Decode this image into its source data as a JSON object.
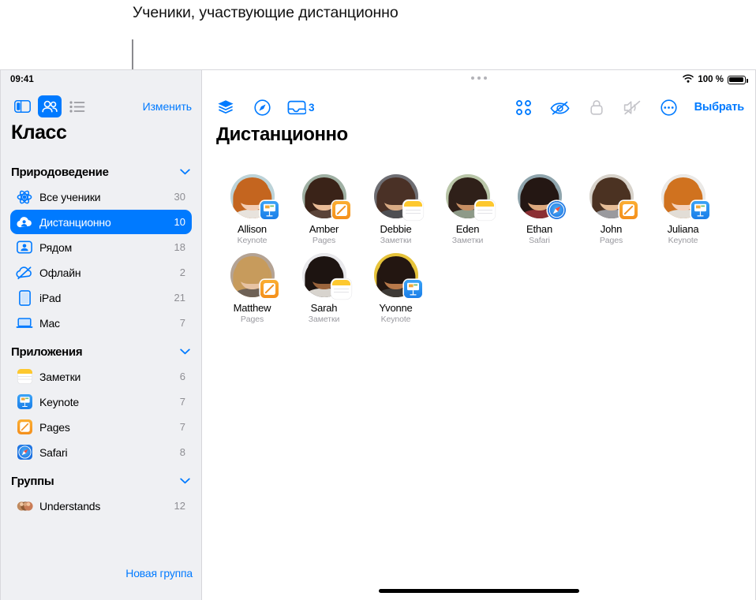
{
  "annotation": {
    "text": "Ученики, участвующие дистанционно"
  },
  "status_bar": {
    "time": "09:41",
    "wifi_icon": "wifi-icon",
    "battery_label": "100 %",
    "battery_icon": "battery-full-icon"
  },
  "sidebar": {
    "toolbar": {
      "sidebar_toggle_icon": "sidebar-toggle-icon",
      "people_icon": "people-icon",
      "list_icon": "list-icon",
      "edit_label": "Изменить"
    },
    "title": "Класс",
    "sections": [
      {
        "title": "Природоведение",
        "chevron_icon": "chevron-down-icon",
        "items": [
          {
            "label": "Все ученики",
            "count": "30",
            "icon": "atom-icon",
            "selected": false
          },
          {
            "label": "Дистанционно",
            "count": "10",
            "icon": "cloud-person-icon",
            "selected": true
          },
          {
            "label": "Рядом",
            "count": "18",
            "icon": "person-card-icon",
            "selected": false
          },
          {
            "label": "Офлайн",
            "count": "2",
            "icon": "cloud-slash-icon",
            "selected": false
          },
          {
            "label": "iPad",
            "count": "21",
            "icon": "ipad-icon",
            "selected": false
          },
          {
            "label": "Mac",
            "count": "7",
            "icon": "laptop-icon",
            "selected": false
          }
        ]
      },
      {
        "title": "Приложения",
        "chevron_icon": "chevron-down-icon",
        "items": [
          {
            "label": "Заметки",
            "count": "6",
            "icon": "notes-app-icon",
            "selected": false
          },
          {
            "label": "Keynote",
            "count": "7",
            "icon": "keynote-app-icon",
            "selected": false
          },
          {
            "label": "Pages",
            "count": "7",
            "icon": "pages-app-icon",
            "selected": false
          },
          {
            "label": "Safari",
            "count": "8",
            "icon": "safari-app-icon",
            "selected": false
          }
        ]
      },
      {
        "title": "Группы",
        "chevron_icon": "chevron-down-icon",
        "items": [
          {
            "label": "Understands",
            "count": "12",
            "icon": "group-avatars-icon",
            "selected": false
          }
        ]
      }
    ],
    "new_group_label": "Новая группа"
  },
  "main": {
    "grabber_icon": "multitasking-grabber-icon",
    "toolbar_left": [
      {
        "name": "layers-icon",
        "label": ""
      },
      {
        "name": "safari-compass-icon",
        "label": ""
      },
      {
        "name": "tray-icon",
        "label": "3"
      }
    ],
    "toolbar_right": [
      {
        "name": "grid-apps-icon",
        "label": "",
        "state": "enabled"
      },
      {
        "name": "eye-slash-icon",
        "label": "",
        "state": "enabled"
      },
      {
        "name": "lock-icon",
        "label": "",
        "state": "disabled"
      },
      {
        "name": "mute-icon",
        "label": "",
        "state": "disabled"
      },
      {
        "name": "more-circle-icon",
        "label": "",
        "state": "enabled"
      }
    ],
    "select_label": "Выбрать",
    "title": "Дистанционно",
    "students": [
      {
        "name": "Allison",
        "app": "Keynote",
        "badge": "keynote",
        "skin": "#f3cdb4",
        "hair": "#c4651f",
        "bg": "#bcd3d8",
        "shirt": "#e8e3dd"
      },
      {
        "name": "Amber",
        "app": "Pages",
        "badge": "pages",
        "skin": "#e9bb96",
        "hair": "#3a2318",
        "bg": "#9fb0a3",
        "shirt": "#5a4338"
      },
      {
        "name": "Debbie",
        "app": "Заметки",
        "badge": "notes",
        "skin": "#d9ab84",
        "hair": "#4a3126",
        "bg": "#6e6e73",
        "shirt": "#4e4e52"
      },
      {
        "name": "Eden",
        "app": "Заметки",
        "badge": "notes",
        "skin": "#c78f63",
        "hair": "#2f2019",
        "bg": "#b9c6a8",
        "shirt": "#8e9a88"
      },
      {
        "name": "Ethan",
        "app": "Safari",
        "badge": "safari",
        "skin": "#dda97e",
        "hair": "#241713",
        "bg": "#8fa5ad",
        "shirt": "#8b2f33"
      },
      {
        "name": "John",
        "app": "Pages",
        "badge": "pages",
        "skin": "#e5bd97",
        "hair": "#4b3222",
        "bg": "#d8d3cb",
        "shirt": "#9a9a9e"
      },
      {
        "name": "Juliana",
        "app": "Keynote",
        "badge": "keynote",
        "skin": "#f5d2bb",
        "hair": "#d0721f",
        "bg": "#ebe9e6",
        "shirt": "#e2ddd6"
      },
      {
        "name": "Matthew",
        "app": "Pages",
        "badge": "pages",
        "skin": "#e7c3a3",
        "hair": "#c79b5c",
        "bg": "#b4a394",
        "shirt": "#6e6156"
      },
      {
        "name": "Sarah",
        "app": "Заметки",
        "badge": "notes",
        "skin": "#9a643c",
        "hair": "#1d1411",
        "bg": "#e9e9ec",
        "shirt": "#d8d4ce"
      },
      {
        "name": "Yvonne",
        "app": "Keynote",
        "badge": "keynote",
        "skin": "#b9794a",
        "hair": "#231611",
        "bg": "#e6c33a",
        "shirt": "#3e3a36"
      }
    ]
  }
}
